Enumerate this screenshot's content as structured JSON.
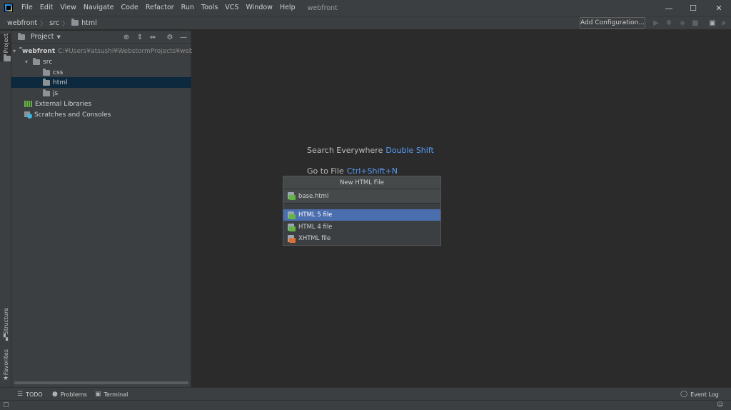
{
  "menubar": {
    "items": [
      "File",
      "Edit",
      "View",
      "Navigate",
      "Code",
      "Refactor",
      "Run",
      "Tools",
      "VCS",
      "Window",
      "Help"
    ],
    "window_title": "webfront"
  },
  "window_controls": {
    "minimize": "—",
    "maximize": "☐",
    "close": "✕"
  },
  "navbar": {
    "crumbs": [
      "webfront",
      "src",
      "html"
    ],
    "add_config_label": "Add Configuration..."
  },
  "left_stripe": {
    "project": "Project",
    "structure": "Structure",
    "favorites": "Favorites"
  },
  "project_panel": {
    "title": "Project",
    "tree": {
      "root": {
        "name": "webfront",
        "path": "C:¥Users¥atsushi¥WebstormProjects¥webfront"
      },
      "src": "src",
      "css": "css",
      "html": "html",
      "js": "js",
      "external_libraries": "External Libraries",
      "scratches": "Scratches and Consoles"
    }
  },
  "editor": {
    "hints": [
      {
        "text": "Search Everywhere",
        "key": "Double Shift"
      },
      {
        "text": "Go to File",
        "key": "Ctrl+Shift+N"
      }
    ]
  },
  "popup": {
    "title": "New HTML File",
    "input_value": "base.html",
    "items": [
      {
        "label": "HTML 5 file",
        "icon": "html-file-icon",
        "selected": true
      },
      {
        "label": "HTML 4 file",
        "icon": "html-file-icon",
        "selected": false
      },
      {
        "label": "XHTML file",
        "icon": "xhtml-file-icon",
        "selected": false
      }
    ]
  },
  "bottom_tabs": {
    "todo": "TODO",
    "problems": "Problems",
    "terminal": "Terminal",
    "event_log": "Event Log"
  },
  "colors": {
    "accent": "#4b6eaf",
    "link": "#589df6",
    "selection": "#0d293e"
  }
}
